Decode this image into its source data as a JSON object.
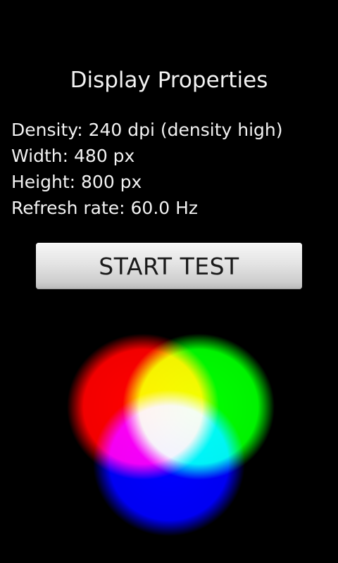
{
  "header": {
    "title": "Display Properties"
  },
  "properties": [
    "Density: 240 dpi (density high)",
    "Width: 480 px",
    "Height: 800 px",
    "Refresh rate: 60.0 Hz"
  ],
  "actions": {
    "start_label": "START TEST"
  },
  "graphic": {
    "colors": [
      "#ff0000",
      "#00ff00",
      "#0000ff"
    ]
  }
}
